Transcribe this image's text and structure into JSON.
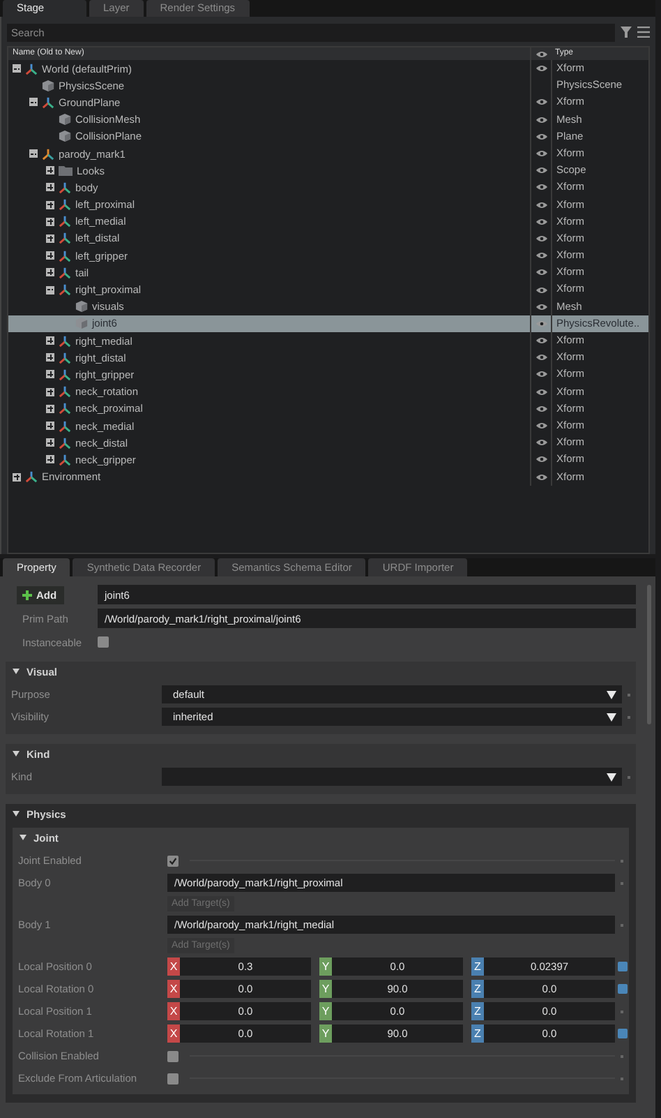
{
  "stage_tabs": [
    {
      "label": "Stage",
      "selected": true
    },
    {
      "label": "Layer",
      "selected": false
    },
    {
      "label": "Render Settings",
      "selected": false
    }
  ],
  "search": {
    "placeholder": "Search"
  },
  "tree": {
    "columns": [
      "Name (Old to New)",
      "Type"
    ],
    "items": [
      {
        "name": "World (defaultPrim)",
        "kind": "xform",
        "type": "Xform",
        "eye": true,
        "expanded": true,
        "selected": false,
        "children": [
          {
            "name": "PhysicsScene",
            "kind": "mesh",
            "type": "PhysicsScene",
            "eye": false,
            "selected": false
          },
          {
            "name": "GroundPlane",
            "kind": "xform",
            "type": "Xform",
            "eye": true,
            "expanded": true,
            "selected": false,
            "children": [
              {
                "name": "CollisionMesh",
                "kind": "mesh",
                "type": "Mesh",
                "eye": true,
                "selected": false
              },
              {
                "name": "CollisionPlane",
                "kind": "mesh",
                "type": "Plane",
                "eye": true,
                "selected": false
              }
            ]
          },
          {
            "name": "parody_mark1",
            "kind": "robot",
            "type": "Xform",
            "eye": true,
            "expanded": true,
            "selected": false,
            "children": [
              {
                "name": "Looks",
                "kind": "scope",
                "type": "Scope",
                "eye": true,
                "expanded": false,
                "selected": false
              },
              {
                "name": "body",
                "kind": "xform",
                "type": "Xform",
                "eye": true,
                "expanded": false,
                "selected": false
              },
              {
                "name": "left_proximal",
                "kind": "xform",
                "type": "Xform",
                "eye": true,
                "expanded": false,
                "selected": false
              },
              {
                "name": "left_medial",
                "kind": "xform",
                "type": "Xform",
                "eye": true,
                "expanded": false,
                "selected": false
              },
              {
                "name": "left_distal",
                "kind": "xform",
                "type": "Xform",
                "eye": true,
                "expanded": false,
                "selected": false
              },
              {
                "name": "left_gripper",
                "kind": "xform",
                "type": "Xform",
                "eye": true,
                "expanded": false,
                "selected": false
              },
              {
                "name": "tail",
                "kind": "xform",
                "type": "Xform",
                "eye": true,
                "expanded": false,
                "selected": false
              },
              {
                "name": "right_proximal",
                "kind": "xform",
                "type": "Xform",
                "eye": true,
                "expanded": true,
                "selected": false,
                "children": [
                  {
                    "name": "visuals",
                    "kind": "mesh",
                    "type": "Mesh",
                    "eye": true,
                    "selected": false
                  },
                  {
                    "name": "joint6",
                    "kind": "mesh",
                    "type": "PhysicsRevolute..",
                    "eye": true,
                    "selected": true
                  }
                ]
              },
              {
                "name": "right_medial",
                "kind": "xform",
                "type": "Xform",
                "eye": true,
                "expanded": false,
                "selected": false
              },
              {
                "name": "right_distal",
                "kind": "xform",
                "type": "Xform",
                "eye": true,
                "expanded": false,
                "selected": false
              },
              {
                "name": "right_gripper",
                "kind": "xform",
                "type": "Xform",
                "eye": true,
                "expanded": false,
                "selected": false
              },
              {
                "name": "neck_rotation",
                "kind": "xform",
                "type": "Xform",
                "eye": true,
                "expanded": false,
                "selected": false
              },
              {
                "name": "neck_proximal",
                "kind": "xform",
                "type": "Xform",
                "eye": true,
                "expanded": false,
                "selected": false
              },
              {
                "name": "neck_medial",
                "kind": "xform",
                "type": "Xform",
                "eye": true,
                "expanded": false,
                "selected": false
              },
              {
                "name": "neck_distal",
                "kind": "xform",
                "type": "Xform",
                "eye": true,
                "expanded": false,
                "selected": false
              },
              {
                "name": "neck_gripper",
                "kind": "xform",
                "type": "Xform",
                "eye": true,
                "expanded": false,
                "selected": false
              }
            ]
          }
        ]
      },
      {
        "name": "Environment",
        "kind": "xform",
        "type": "Xform",
        "eye": true,
        "expanded": false,
        "selected": false
      }
    ]
  },
  "property_tabs": [
    {
      "label": "Property",
      "selected": true
    },
    {
      "label": "Synthetic Data Recorder",
      "selected": false
    },
    {
      "label": "Semantics Schema Editor",
      "selected": false
    },
    {
      "label": "URDF Importer",
      "selected": false
    }
  ],
  "prim": {
    "add_label": "Add",
    "name": "joint6",
    "path_label": "Prim Path",
    "path": "/World/parody_mark1/right_proximal/joint6",
    "instanceable_label": "Instanceable",
    "instanceable": false
  },
  "sections": [
    {
      "title": "Visual",
      "expanded": true,
      "rows": [
        {
          "kind": "dropdown",
          "label": "Purpose",
          "value": "default"
        },
        {
          "kind": "dropdown",
          "label": "Visibility",
          "value": "inherited"
        }
      ]
    },
    {
      "title": "Kind",
      "expanded": true,
      "rows": [
        {
          "kind": "dropdown",
          "label": "Kind"
        }
      ]
    },
    {
      "title": "Physics",
      "expanded": true,
      "subsections": [
        {
          "title": "Joint",
          "expanded": true,
          "rows": [
            {
              "kind": "checkbox",
              "label": "Joint Enabled",
              "checked": true
            },
            {
              "kind": "target",
              "label": "Body 0",
              "value": "/World/parody_mark1/right_proximal",
              "add_label": "Add Target(s)"
            },
            {
              "kind": "target",
              "label": "Body 1",
              "value": "/World/parody_mark1/right_medial",
              "add_label": "Add Target(s)"
            },
            {
              "kind": "vector",
              "label": "Local Position 0",
              "modified": true,
              "components": [
                {
                  "axis": "X",
                  "value": "0.3"
                },
                {
                  "axis": "Y",
                  "value": "0.0"
                },
                {
                  "axis": "Z",
                  "value": "0.02397"
                }
              ]
            },
            {
              "kind": "vector",
              "label": "Local Rotation 0",
              "modified": true,
              "components": [
                {
                  "axis": "X",
                  "value": "0.0"
                },
                {
                  "axis": "Y",
                  "value": "90.0"
                },
                {
                  "axis": "Z",
                  "value": "0.0"
                }
              ]
            },
            {
              "kind": "vector",
              "label": "Local Position 1",
              "modified": false,
              "components": [
                {
                  "axis": "X",
                  "value": "0.0"
                },
                {
                  "axis": "Y",
                  "value": "0.0"
                },
                {
                  "axis": "Z",
                  "value": "0.0"
                }
              ]
            },
            {
              "kind": "vector",
              "label": "Local Rotation 1",
              "modified": true,
              "components": [
                {
                  "axis": "X",
                  "value": "0.0"
                },
                {
                  "axis": "Y",
                  "value": "90.0"
                },
                {
                  "axis": "Z",
                  "value": "0.0"
                }
              ]
            },
            {
              "kind": "checkbox",
              "label": "Collision Enabled",
              "checked": false
            },
            {
              "kind": "checkbox",
              "label": "Exclude From Articulation",
              "checked": false
            }
          ]
        }
      ]
    }
  ]
}
